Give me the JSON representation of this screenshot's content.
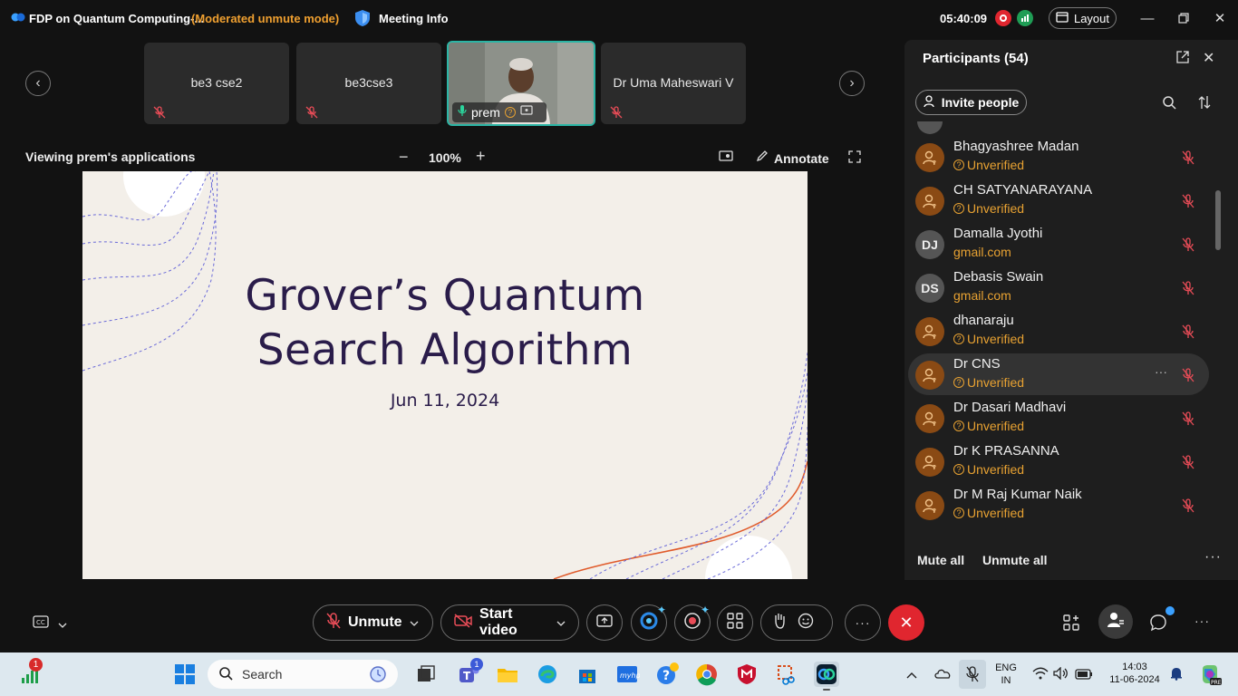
{
  "titlebar": {
    "app_title": "FDP on Quantum Computing-...",
    "mode": "(Moderated unmute mode)",
    "meeting_info": "Meeting Info",
    "timer": "05:40:09",
    "layout_label": "Layout"
  },
  "thumbnails": [
    {
      "name": "be3 cse2"
    },
    {
      "name": "be3cse3"
    },
    {
      "name": "prem"
    },
    {
      "name": "Dr Uma Maheswari V"
    }
  ],
  "share": {
    "viewing_label": "Viewing prem's applications",
    "zoom": "100%",
    "annotate_label": "Annotate"
  },
  "slide": {
    "title_line1": "Grover’s Quantum",
    "title_line2": "Search Algorithm",
    "date": "Jun 11, 2024"
  },
  "participants": {
    "title": "Participants (54)",
    "invite_label": "Invite people",
    "mute_all": "Mute all",
    "unmute_all": "Unmute all",
    "list": [
      {
        "name": "Bhagyashree Madan",
        "sub": "Unverified",
        "avatar": ""
      },
      {
        "name": "CH SATYANARAYANA",
        "sub": "Unverified",
        "avatar": ""
      },
      {
        "name": "Damalla Jyothi",
        "sub": "gmail.com",
        "avatar": "DJ"
      },
      {
        "name": "Debasis Swain",
        "sub": "gmail.com",
        "avatar": "DS"
      },
      {
        "name": "dhanaraju",
        "sub": "Unverified",
        "avatar": ""
      },
      {
        "name": "Dr CNS",
        "sub": "Unverified",
        "avatar": ""
      },
      {
        "name": "Dr Dasari Madhavi",
        "sub": "Unverified",
        "avatar": ""
      },
      {
        "name": "Dr K PRASANNA",
        "sub": "Unverified",
        "avatar": ""
      },
      {
        "name": "Dr M Raj Kumar Naik",
        "sub": "Unverified",
        "avatar": ""
      }
    ]
  },
  "controls": {
    "unmute_label": "Unmute",
    "start_video_label": "Start video"
  },
  "taskbar": {
    "search_placeholder": "Search",
    "lang_line1": "ENG",
    "lang_line2": "IN",
    "time": "14:03",
    "date": "11-06-2024",
    "widget_badge": "1",
    "teams_badge": "1"
  },
  "colors": {
    "accent_orange": "#e8a232",
    "leave_red": "#e0262f",
    "active_tile_border": "#2bb5a5",
    "slide_text": "#2a1c4a"
  }
}
